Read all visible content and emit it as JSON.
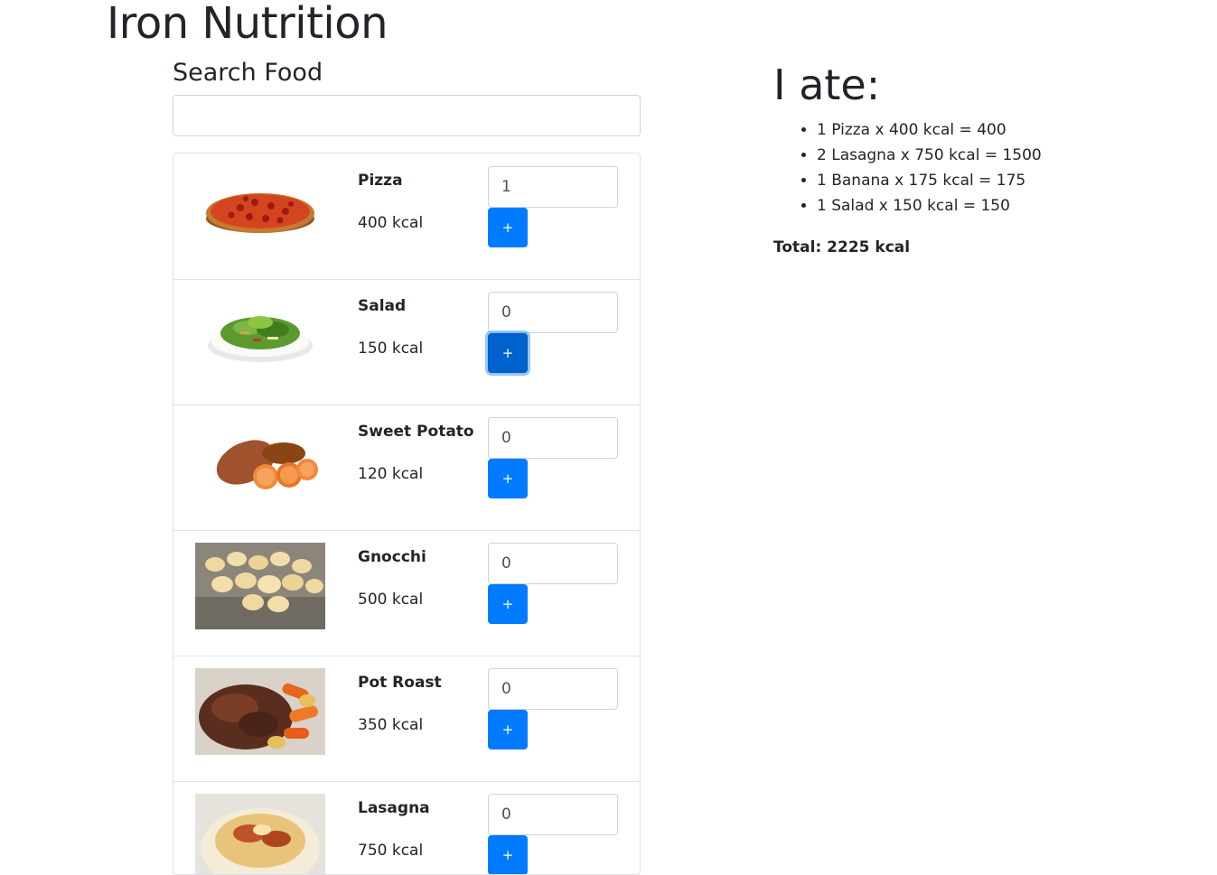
{
  "app": {
    "title": "Iron Nutrition"
  },
  "search": {
    "label": "Search Food",
    "value": "",
    "placeholder": ""
  },
  "foods": [
    {
      "name": "Pizza",
      "calories": "400 kcal",
      "quantity": "1",
      "add_label": "+",
      "image_icon": "pizza-image"
    },
    {
      "name": "Salad",
      "calories": "150 kcal",
      "quantity": "0",
      "add_label": "+",
      "image_icon": "salad-image"
    },
    {
      "name": "Sweet Potato",
      "calories": "120 kcal",
      "quantity": "0",
      "add_label": "+",
      "image_icon": "sweet-potato-image"
    },
    {
      "name": "Gnocchi",
      "calories": "500 kcal",
      "quantity": "0",
      "add_label": "+",
      "image_icon": "gnocchi-image"
    },
    {
      "name": "Pot Roast",
      "calories": "350 kcal",
      "quantity": "0",
      "add_label": "+",
      "image_icon": "pot-roast-image"
    },
    {
      "name": "Lasagna",
      "calories": "750 kcal",
      "quantity": "0",
      "add_label": "+",
      "image_icon": "lasagna-image"
    }
  ],
  "today": {
    "title": "I ate:",
    "items": [
      "1 Pizza x 400 kcal = 400",
      "2 Lasagna x 750 kcal = 1500",
      "1 Banana x 175 kcal = 175",
      "1 Salad x 150 kcal = 150"
    ],
    "total": "Total: 2225 kcal"
  },
  "colors": {
    "primary": "#007bff",
    "primary_focused": "#0062cc",
    "border": "#dee2e6",
    "text": "#212529"
  }
}
